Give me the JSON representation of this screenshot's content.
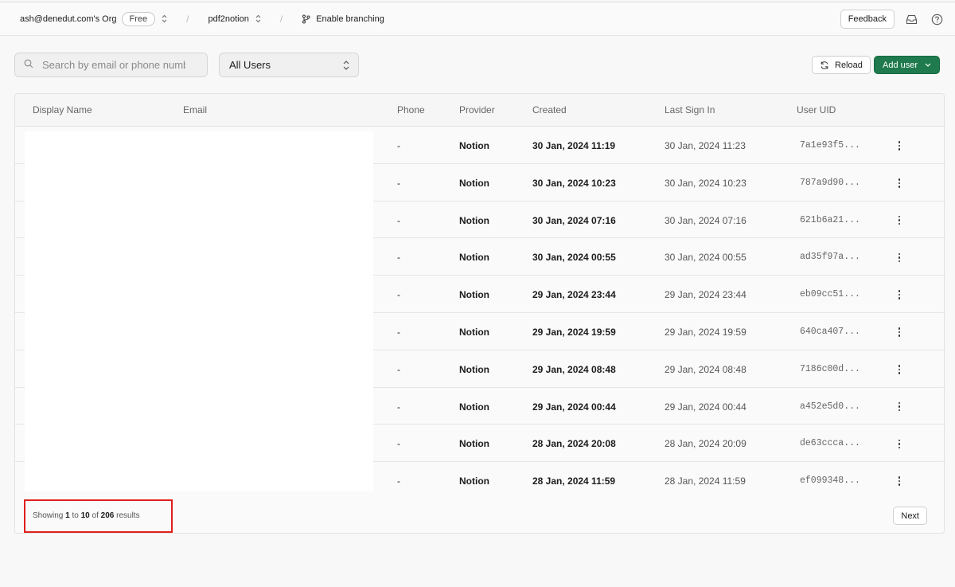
{
  "header": {
    "org": "ash@denedut.com's Org",
    "plan": "Free",
    "project": "pdf2notion",
    "branching": "Enable branching",
    "feedback": "Feedback"
  },
  "toolbar": {
    "search_placeholder": "Search by email or phone numb",
    "filter_value": "All Users",
    "reload": "Reload",
    "add_user": "Add user"
  },
  "table": {
    "columns": [
      "Display Name",
      "Email",
      "Phone",
      "Provider",
      "Created",
      "Last Sign In",
      "User UID"
    ],
    "rows": [
      {
        "phone": "-",
        "provider": "Notion",
        "created": "30 Jan, 2024 11:19",
        "last_sign_in": "30 Jan, 2024 11:23",
        "uid": "7a1e93f5..."
      },
      {
        "phone": "-",
        "provider": "Notion",
        "created": "30 Jan, 2024 10:23",
        "last_sign_in": "30 Jan, 2024 10:23",
        "uid": "787a9d90..."
      },
      {
        "phone": "-",
        "provider": "Notion",
        "created": "30 Jan, 2024 07:16",
        "last_sign_in": "30 Jan, 2024 07:16",
        "uid": "621b6a21..."
      },
      {
        "phone": "-",
        "provider": "Notion",
        "created": "30 Jan, 2024 00:55",
        "last_sign_in": "30 Jan, 2024 00:55",
        "uid": "ad35f97a..."
      },
      {
        "phone": "-",
        "provider": "Notion",
        "created": "29 Jan, 2024 23:44",
        "last_sign_in": "29 Jan, 2024 23:44",
        "uid": "eb09cc51..."
      },
      {
        "phone": "-",
        "provider": "Notion",
        "created": "29 Jan, 2024 19:59",
        "last_sign_in": "29 Jan, 2024 19:59",
        "uid": "640ca407..."
      },
      {
        "phone": "-",
        "provider": "Notion",
        "created": "29 Jan, 2024 08:48",
        "last_sign_in": "29 Jan, 2024 08:48",
        "uid": "7186c00d..."
      },
      {
        "phone": "-",
        "provider": "Notion",
        "created": "29 Jan, 2024 00:44",
        "last_sign_in": "29 Jan, 2024 00:44",
        "uid": "a452e5d0..."
      },
      {
        "phone": "-",
        "provider": "Notion",
        "created": "28 Jan, 2024 20:08",
        "last_sign_in": "28 Jan, 2024 20:09",
        "uid": "de63ccca..."
      },
      {
        "phone": "-",
        "provider": "Notion",
        "created": "28 Jan, 2024 11:59",
        "last_sign_in": "28 Jan, 2024 11:59",
        "uid": "ef099348..."
      }
    ]
  },
  "footer": {
    "showing": "Showing",
    "from": "1",
    "to_label": "to",
    "to": "10",
    "of_label": "of",
    "total": "206",
    "results": "results",
    "next": "Next"
  }
}
